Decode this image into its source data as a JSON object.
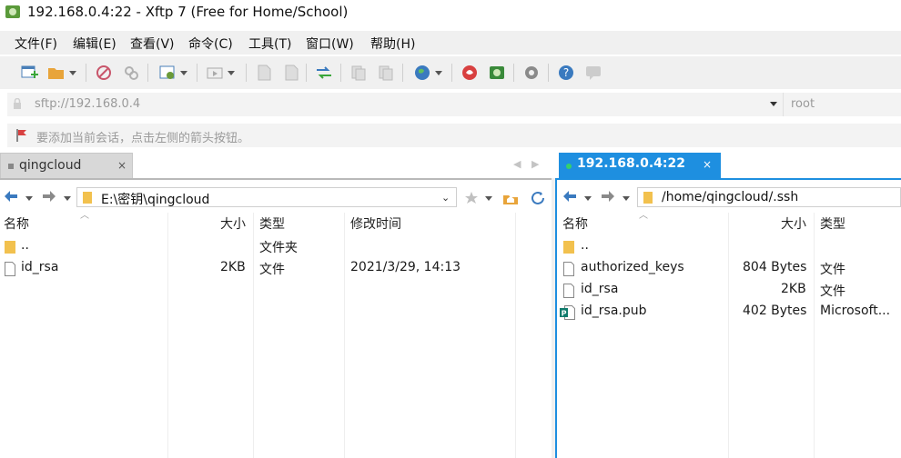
{
  "window": {
    "title": "192.168.0.4:22 - Xftp 7 (Free for Home/School)"
  },
  "menu": [
    "文件(F)",
    "编辑(E)",
    "查看(V)",
    "命令(C)",
    "工具(T)",
    "窗口(W)",
    "帮助(H)"
  ],
  "address": {
    "url": "sftp://192.168.0.4",
    "user": "root"
  },
  "hint": "要添加当前会话，点击左侧的箭头按钮。",
  "tabs": {
    "local": {
      "label": "qingcloud",
      "close": "×"
    },
    "remote": {
      "label": "192.168.0.4:22",
      "close": "×"
    },
    "nav_prev": "◀",
    "nav_next": "▶"
  },
  "local": {
    "path": "E:\\密钥\\qingcloud",
    "columns": [
      "名称",
      "大小",
      "类型",
      "修改时间"
    ],
    "rows": [
      {
        "name": "..",
        "size": "",
        "type": "文件夹",
        "modified": ""
      },
      {
        "name": "id_rsa",
        "size": "2KB",
        "type": "文件",
        "modified": "2021/3/29, 14:13"
      }
    ]
  },
  "remote": {
    "path": "/home/qingcloud/.ssh",
    "columns": [
      "名称",
      "大小",
      "类型"
    ],
    "rows": [
      {
        "name": "..",
        "size": "",
        "type": ""
      },
      {
        "name": "authorized_keys",
        "size": "804 Bytes",
        "type": "文件"
      },
      {
        "name": "id_rsa",
        "size": "2KB",
        "type": "文件"
      },
      {
        "name": "id_rsa.pub",
        "size": "402 Bytes",
        "type": "Microsoft..."
      }
    ]
  },
  "colors": {
    "accent": "#1e8fe0",
    "remote_dot": "#36d06a",
    "folder": "#f2c14e"
  }
}
